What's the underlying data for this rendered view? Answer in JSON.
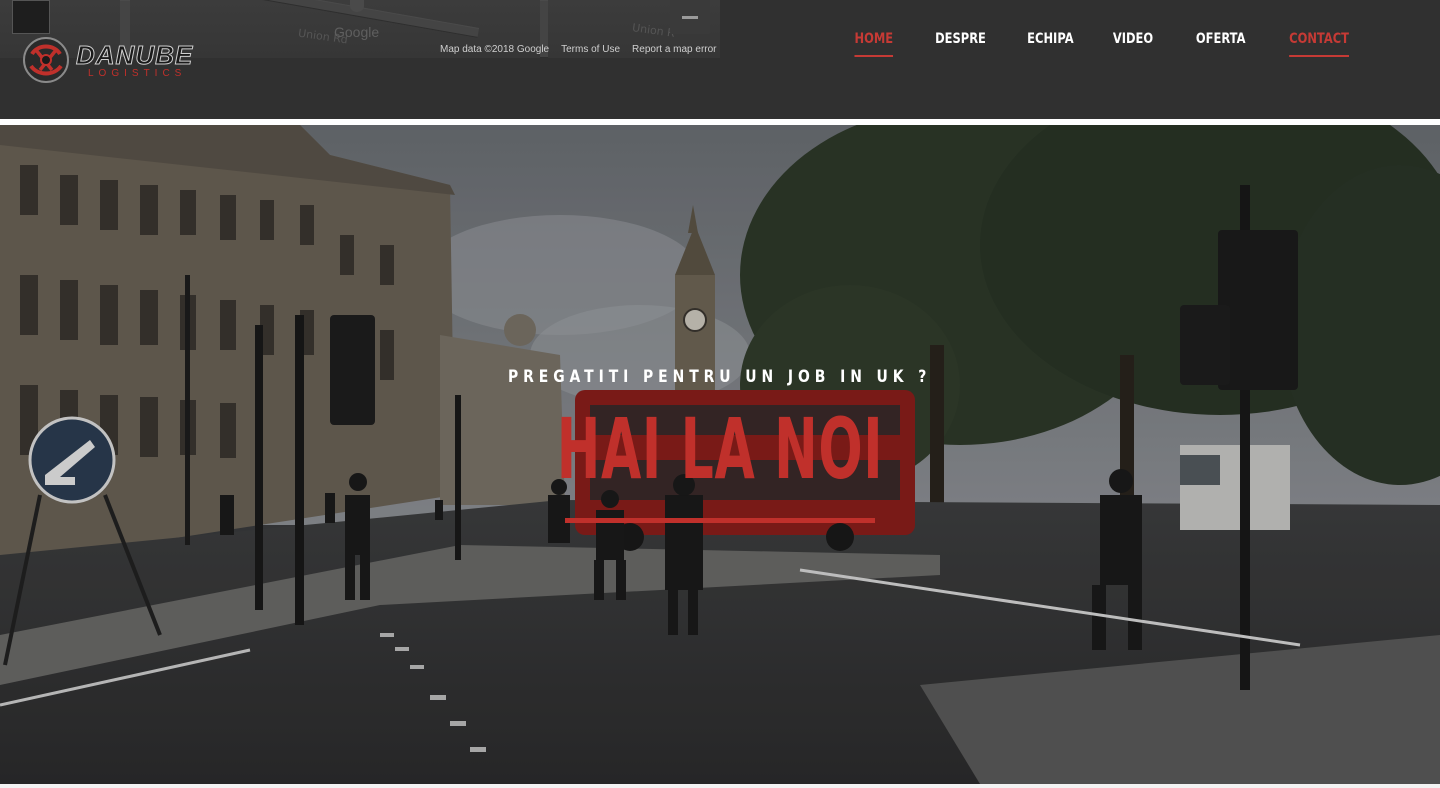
{
  "map": {
    "road_label_1": "Union Rd",
    "road_label_2": "Union R",
    "brand": "Google",
    "footer": [
      "Map data ©2018 Google",
      "Terms of Use",
      "Report a map error"
    ]
  },
  "logo": {
    "main": "DANUBE",
    "sub": "LOGISTICS"
  },
  "nav": {
    "items": [
      {
        "label": "HOME",
        "active": true
      },
      {
        "label": "DESPRE",
        "active": false
      },
      {
        "label": "ECHIPA",
        "active": false
      },
      {
        "label": "VIDEO",
        "active": false
      },
      {
        "label": "OFERTA",
        "active": false
      },
      {
        "label": "CONTACT",
        "active": false
      }
    ]
  },
  "hero": {
    "subtitle": "PREGATITI PENTRU UN JOB IN UK ?",
    "title": "HAI LA NOI"
  },
  "colors": {
    "accent": "#c0302b",
    "header_bg": "#303030",
    "text": "#ffffff"
  },
  "icons": [
    "logo-globe-icon",
    "map-pin-icon",
    "map-zoom-out-icon"
  ]
}
